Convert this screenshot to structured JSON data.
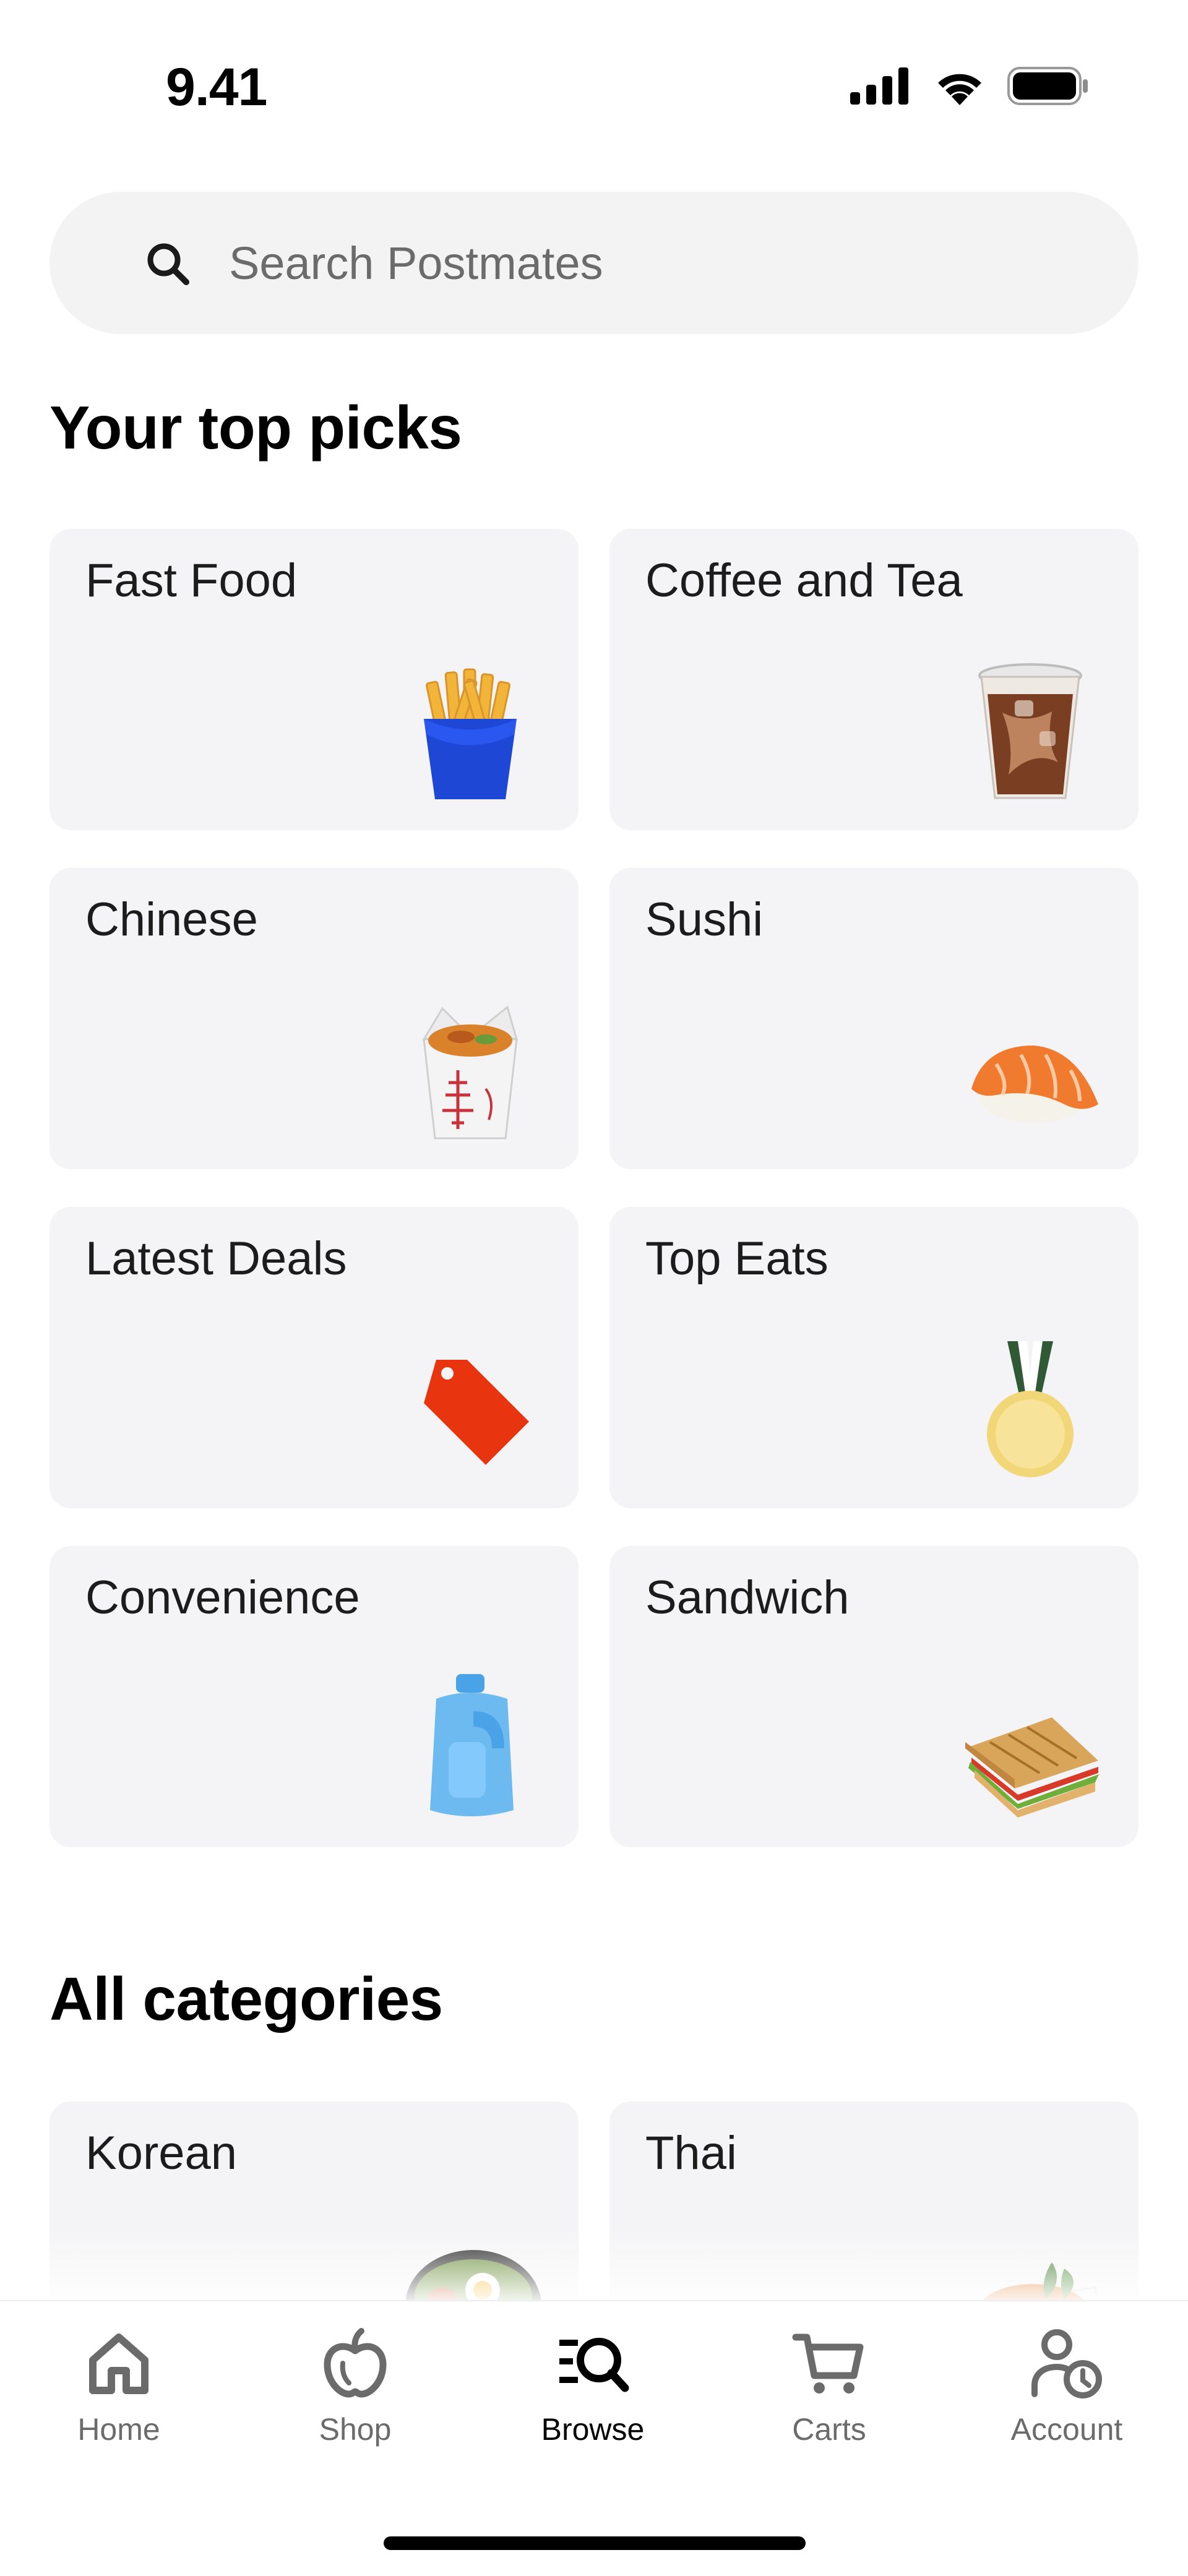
{
  "status_bar": {
    "time": "9.41",
    "icons": [
      "signal-icon",
      "wifi-icon",
      "battery-icon"
    ]
  },
  "search": {
    "placeholder": "Search Postmates",
    "value": ""
  },
  "top_picks": {
    "title": "Your top picks",
    "items": [
      {
        "label": "Fast Food",
        "icon": "fries-icon"
      },
      {
        "label": "Coffee and Tea",
        "icon": "iced-coffee-icon"
      },
      {
        "label": "Chinese",
        "icon": "takeout-box-icon"
      },
      {
        "label": "Sushi",
        "icon": "sushi-icon"
      },
      {
        "label": "Latest Deals",
        "icon": "price-tag-icon"
      },
      {
        "label": "Top Eats",
        "icon": "medal-icon"
      },
      {
        "label": "Convenience",
        "icon": "detergent-bottle-icon"
      },
      {
        "label": "Sandwich",
        "icon": "sandwich-icon"
      }
    ]
  },
  "all_categories": {
    "title": "All categories",
    "items": [
      {
        "label": "Korean",
        "icon": "bibimbap-bowl-icon"
      },
      {
        "label": "Thai",
        "icon": "thai-dish-icon"
      }
    ]
  },
  "bottom_nav": {
    "items": [
      {
        "label": "Home",
        "icon": "home-icon",
        "active": false
      },
      {
        "label": "Shop",
        "icon": "apple-icon",
        "active": false
      },
      {
        "label": "Browse",
        "icon": "browse-icon",
        "active": true
      },
      {
        "label": "Carts",
        "icon": "cart-icon",
        "active": false
      },
      {
        "label": "Account",
        "icon": "account-icon",
        "active": false
      }
    ]
  },
  "colors": {
    "card_background": "#f4f4f6",
    "search_background": "#f3f3f3",
    "inactive_nav": "#6b6b6b",
    "active_nav": "#000000"
  }
}
